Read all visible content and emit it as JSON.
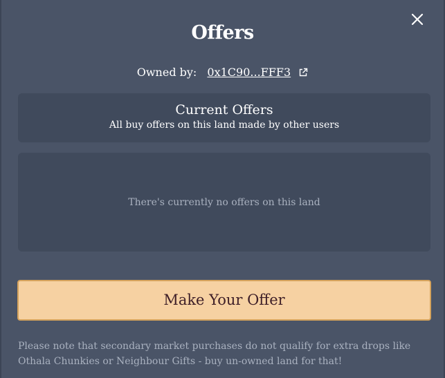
{
  "modal": {
    "title": "Offers",
    "owned_label": "Owned by:",
    "owner_address": "0x1C90...FFF3",
    "close_icon": "close-icon",
    "external_link_icon": "external-link-icon"
  },
  "current_offers": {
    "title": "Current Offers",
    "subtitle": "All buy offers on this land made by other users",
    "empty_message": "There's currently no offers on this land"
  },
  "actions": {
    "make_offer_label": "Make Your Offer"
  },
  "footer": {
    "note": "Please note that secondary market purchases do not qualify for extra drops like Othala Chunkies or Neighbour Gifts - buy un-owned land for that!"
  },
  "colors": {
    "background": "#4a5467",
    "panel": "#404a5c",
    "button_fill": "#f6d1a2",
    "button_border": "#d6a35c",
    "button_text": "#3d1e27",
    "muted_text": "#aab2c0"
  }
}
